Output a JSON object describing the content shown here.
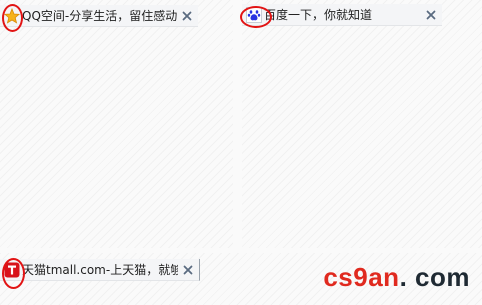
{
  "tabs": [
    {
      "title": "QQ空间-分享生活，留住感动",
      "favicon": "qzone-star-icon",
      "close": "close-icon"
    },
    {
      "title": "百度一下，你就知道",
      "favicon": "baidu-paw-icon",
      "close": "close-icon"
    },
    {
      "title": "天猫tmall.com-上天猫，就够了",
      "favicon": "tmall-t-icon",
      "close": "close-icon"
    }
  ],
  "watermark": {
    "part1": "cs9an",
    "part2": ". com"
  },
  "colors": {
    "highlight_ring": "#e21414",
    "tab_bg": "#f4f5f7",
    "close_x": "#5a6b80",
    "tmall_red": "#d8131b",
    "baidu_blue": "#2932e1",
    "qzone_yellow": "#f6b21a",
    "watermark_red": "#e02a1f",
    "watermark_dark": "#1f2a33"
  }
}
